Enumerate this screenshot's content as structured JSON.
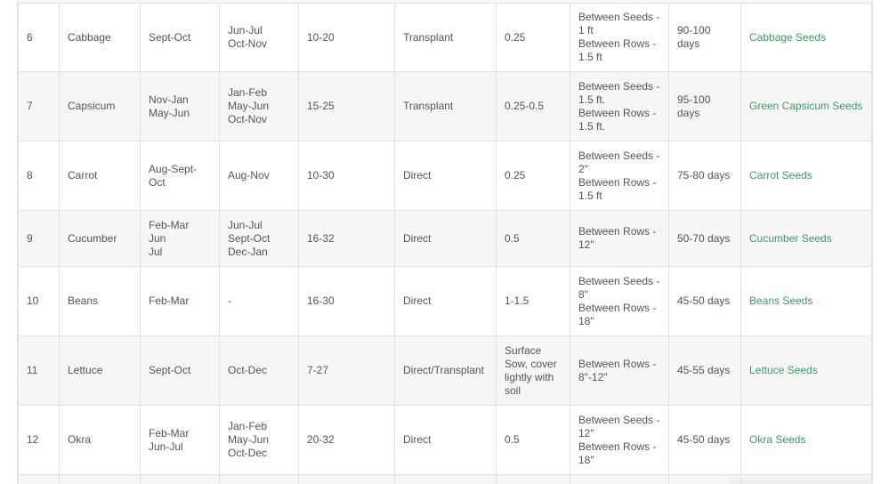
{
  "table": {
    "rows": [
      {
        "no": "6",
        "crop": "Cabbage",
        "sowing": [
          "Sept-Oct"
        ],
        "transplanting": [
          "Jun-Jul",
          "Oct-Nov"
        ],
        "temp": "10-20",
        "method": "Transplant",
        "depth": "0.25",
        "spacing": [
          "Between Seeds -",
          "1 ft",
          "Between Rows -",
          "1.5 ft"
        ],
        "harvest": [
          "90-100",
          "days"
        ],
        "link": "Cabbage Seeds"
      },
      {
        "no": "7",
        "crop": "Capsicum",
        "sowing": [
          "Nov-Jan",
          "May-Jun"
        ],
        "transplanting": [
          "Jan-Feb",
          "May-Jun",
          "Oct-Nov"
        ],
        "temp": "15-25",
        "method": "Transplant",
        "depth": "0.25-0.5",
        "spacing": [
          "Between Seeds -",
          "1.5 ft.",
          "Between Rows -",
          "1.5 ft."
        ],
        "harvest": [
          "95-100",
          "days"
        ],
        "link": "Green Capsicum Seeds"
      },
      {
        "no": "8",
        "crop": "Carrot",
        "sowing": [
          "Aug-Sept-",
          "Oct"
        ],
        "transplanting": [
          "Aug-Nov"
        ],
        "temp": "10-30",
        "method": "Direct",
        "depth": "0.25",
        "spacing": [
          "Between Seeds -",
          "2\"",
          "Between Rows -",
          "1.5 ft"
        ],
        "harvest": [
          "75-80 days"
        ],
        "link": "Carrot Seeds"
      },
      {
        "no": "9",
        "crop": "Cucumber",
        "sowing": [
          "Feb-Mar",
          "Jun",
          "Jul"
        ],
        "transplanting": [
          "Jun-Jul",
          "Sept-Oct",
          "Dec-Jan"
        ],
        "temp": "16-32",
        "method": "Direct",
        "depth": "0.5",
        "spacing": [
          "Between Rows -",
          "12\""
        ],
        "harvest": [
          "50-70 days"
        ],
        "link": "Cucumber Seeds"
      },
      {
        "no": "10",
        "crop": "Beans",
        "sowing": [
          "Feb-Mar"
        ],
        "transplanting": [
          "-"
        ],
        "temp": "16-30",
        "method": "Direct",
        "depth": "1-1.5",
        "spacing": [
          "Between Seeds -",
          "8\"",
          "Between Rows -",
          "18\""
        ],
        "harvest": [
          "45-50 days"
        ],
        "link": "Beans Seeds"
      },
      {
        "no": "11",
        "crop": "Lettuce",
        "sowing": [
          "Sept-Oct"
        ],
        "transplanting": [
          "Oct-Dec"
        ],
        "temp": "7-27",
        "method": "Direct/Transplant",
        "depth_lines": [
          "Surface",
          "Sow, cover",
          "lightly with",
          "soil"
        ],
        "spacing": [
          "Between Rows -",
          "8\"-12\""
        ],
        "harvest": [
          "45-55 days"
        ],
        "link": "Lettuce Seeds"
      },
      {
        "no": "12",
        "crop": "Okra",
        "sowing": [
          "Feb-Mar",
          "Jun-Jul"
        ],
        "transplanting": [
          "Jan-Feb",
          "May-Jun",
          "Oct-Dec"
        ],
        "temp": "20-32",
        "method": "Direct",
        "depth": "0.5",
        "spacing": [
          "Between Seeds -",
          "12\"",
          "Between Rows -",
          "18\""
        ],
        "harvest": [
          "45-50 days"
        ],
        "link": "Okra Seeds"
      }
    ]
  },
  "colors": {
    "link": "#3e9a68",
    "text": "#555555",
    "stripe": "#f6f6f6",
    "border": "#e2e2e2"
  }
}
